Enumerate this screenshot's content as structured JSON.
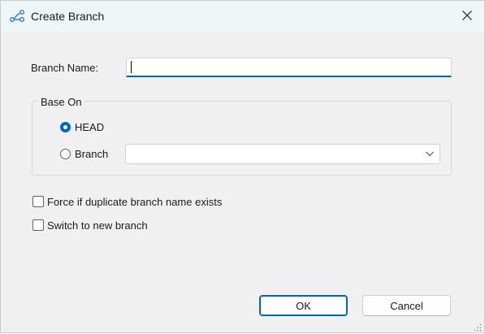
{
  "window": {
    "title": "Create Branch",
    "icon": "branch-icon",
    "close_icon": "close-icon"
  },
  "form": {
    "branch_name_label": "Branch Name:",
    "branch_name_value": "",
    "base_on_title": "Base On",
    "head_label": "HEAD",
    "head_selected": true,
    "branch_label": "Branch",
    "branch_selected": false,
    "branch_select_value": "",
    "force_label": "Force if duplicate branch name exists",
    "force_checked": false,
    "switch_label": "Switch to new branch",
    "switch_checked": false
  },
  "buttons": {
    "ok_label": "OK",
    "cancel_label": "Cancel"
  },
  "colors": {
    "accent": "#0067c0",
    "titlebar_bg": "#eef6f8",
    "window_bg": "#f0f0f0"
  }
}
